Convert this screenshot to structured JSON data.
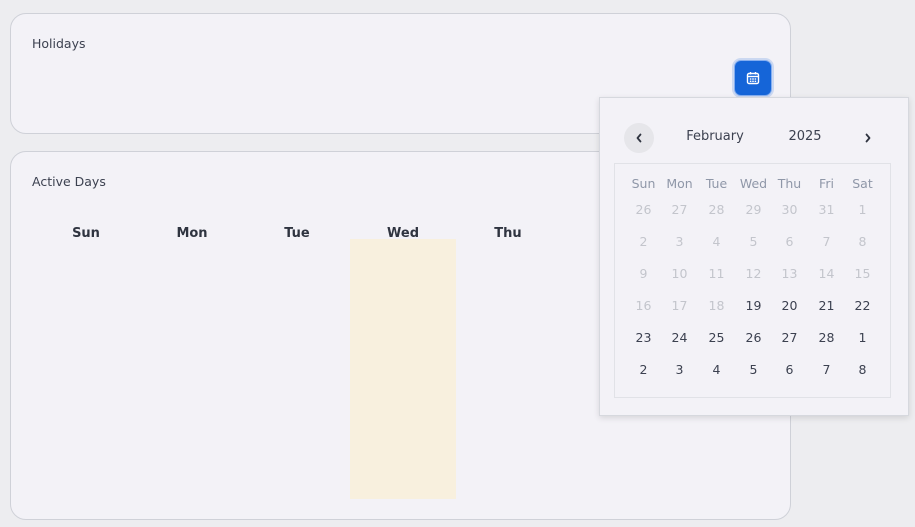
{
  "holidays": {
    "title": "Holidays"
  },
  "active_days": {
    "title": "Active Days",
    "weekdays": [
      "Sun",
      "Mon",
      "Tue",
      "Wed",
      "Thu"
    ]
  },
  "datepicker": {
    "month": "February",
    "year": "2025",
    "prev_symbol": "‹",
    "next_symbol": "›",
    "weekday_headers": [
      "Sun",
      "Mon",
      "Tue",
      "Wed",
      "Thu",
      "Fri",
      "Sat"
    ],
    "weeks": [
      [
        "26",
        "27",
        "28",
        "29",
        "30",
        "31",
        "1"
      ],
      [
        "2",
        "3",
        "4",
        "5",
        "6",
        "7",
        "8"
      ],
      [
        "9",
        "10",
        "11",
        "12",
        "13",
        "14",
        "15"
      ],
      [
        "16",
        "17",
        "18",
        "19",
        "20",
        "21",
        "22"
      ],
      [
        "23",
        "24",
        "25",
        "26",
        "27",
        "28",
        "1"
      ],
      [
        "2",
        "3",
        "4",
        "5",
        "6",
        "7",
        "8"
      ]
    ],
    "disabled": [
      [
        true,
        true,
        true,
        true,
        true,
        true,
        true
      ],
      [
        true,
        true,
        true,
        true,
        true,
        true,
        true
      ],
      [
        true,
        true,
        true,
        true,
        true,
        true,
        true
      ],
      [
        true,
        true,
        true,
        false,
        false,
        false,
        false
      ],
      [
        false,
        false,
        false,
        false,
        false,
        false,
        false
      ],
      [
        false,
        false,
        false,
        false,
        false,
        false,
        false
      ]
    ]
  },
  "colors": {
    "accent": "#1565d8",
    "highlight_column": "#f8f0de"
  },
  "icons": {
    "calendar_button": "calendar-icon"
  }
}
